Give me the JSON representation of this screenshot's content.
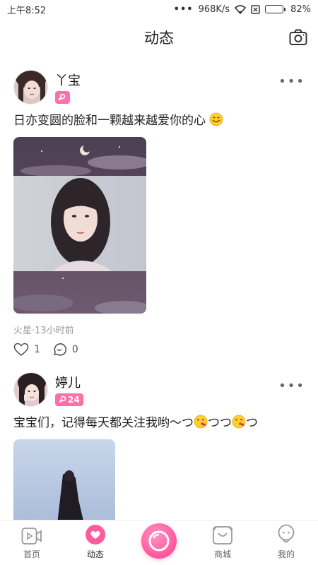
{
  "status_bar": {
    "time": "上午8:52",
    "dots": "•••",
    "speed": "968K/s",
    "battery": "82%",
    "battery_level": 0.82
  },
  "header": {
    "title": "动态"
  },
  "posts": [
    {
      "username": "丫宝",
      "badge": "",
      "content": "日亦变圆的脸和一颗越来越爱你的心",
      "meta": "火星·13小时前",
      "likes": "1",
      "comments": "0"
    },
    {
      "username": "婷儿",
      "badge": "24",
      "content": "宝宝们，记得每天都关注我哟～つ",
      "content_b": "つつ",
      "content_c": "つ"
    }
  ],
  "tabs": [
    {
      "label": "首页",
      "icon": "video-icon"
    },
    {
      "label": "动态",
      "icon": "heart-icon"
    },
    {
      "label": "",
      "icon": "live-icon"
    },
    {
      "label": "商城",
      "icon": "shop-bag-icon"
    },
    {
      "label": "我的",
      "icon": "profile-icon"
    }
  ],
  "colors": {
    "accent": "#ff5c9e",
    "badge": "#ff6fa8"
  }
}
